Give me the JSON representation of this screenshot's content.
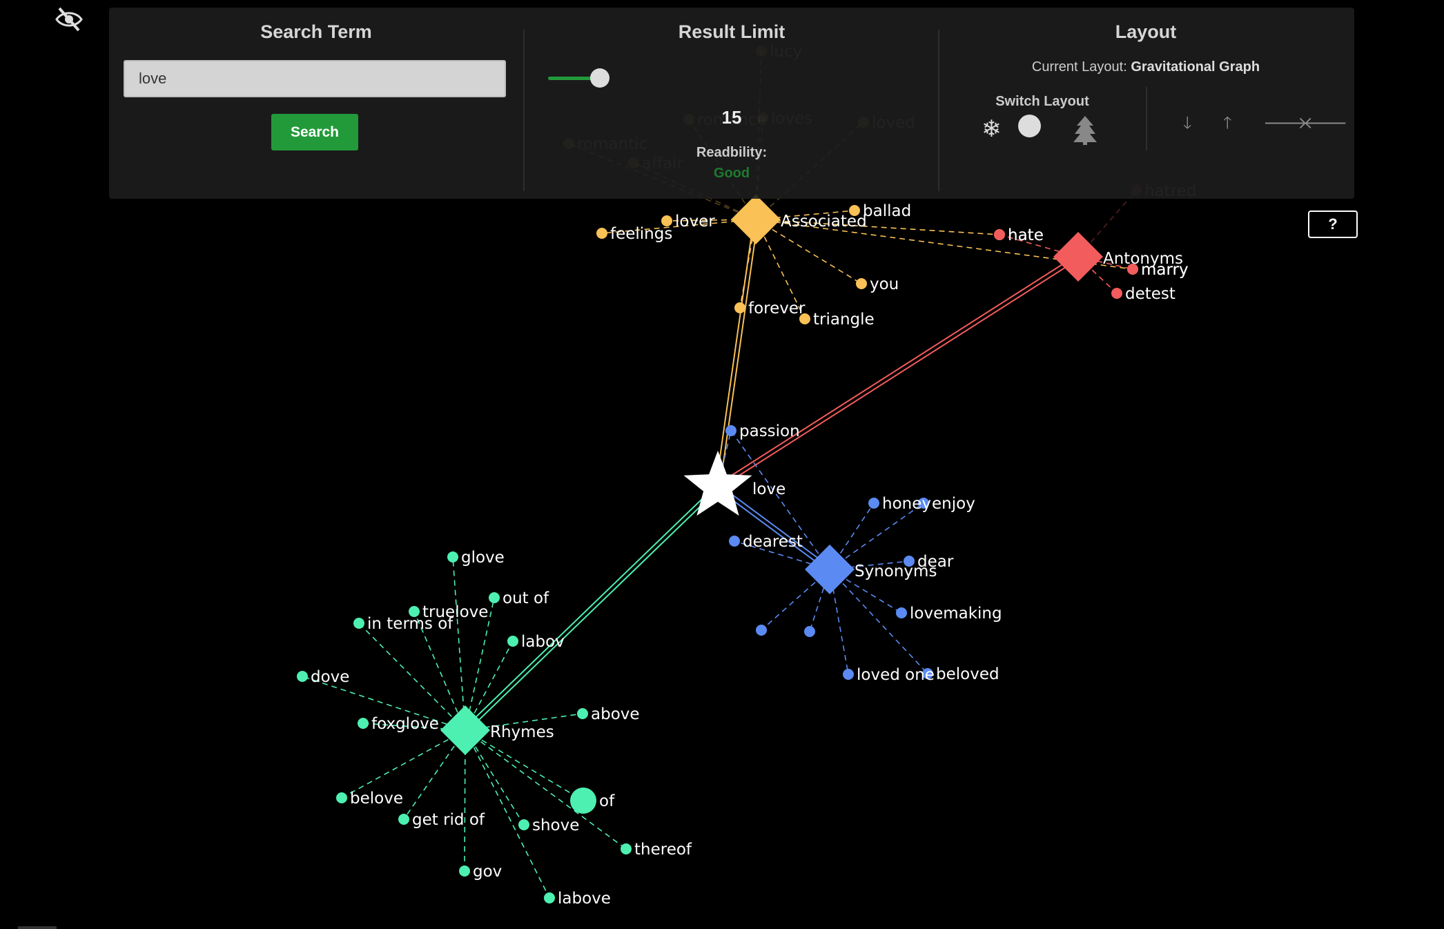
{
  "search": {
    "title": "Search Term",
    "value": "love",
    "button": "Search"
  },
  "limit": {
    "title": "Result Limit",
    "value": "15",
    "readability_label": "Readbility:",
    "readability_value": "Good"
  },
  "layout": {
    "title": "Layout",
    "current_label": "Current Layout:",
    "current_value": "Gravitational Graph",
    "switch_label": "Switch Layout",
    "switch_icons": [
      "snowflake-icon",
      "tree-icon"
    ],
    "arrow_icons": [
      "arrow-down-icon",
      "arrow-up-icon",
      "arrow-right-icon",
      "arrow-left-icon"
    ]
  },
  "help": "?",
  "colors": {
    "associated": "#f9c156",
    "antonyms": "#f25c5c",
    "synonyms": "#5b8bf2",
    "rhymes": "#4df0b0",
    "accent": "#229a3a"
  },
  "graph": {
    "center": "love",
    "hubs": {
      "associated": "Associated",
      "antonyms": "Antonyms",
      "synonyms": "Synonyms",
      "rhymes": "Rhymes"
    },
    "associated_words": [
      "lucy",
      "romance",
      "loves",
      "loved",
      "romantic",
      "affair",
      "feelings",
      "lover",
      "ballad",
      "hate",
      "marry",
      "you",
      "forever",
      "triangle"
    ],
    "antonym_words": [
      "hatred",
      "hate",
      "detest",
      "marry"
    ],
    "synonym_words": [
      "passion",
      "honey",
      "enjoy",
      "dearest",
      "dear",
      "lovemaking",
      "loved one",
      "beloved"
    ],
    "rhyme_words": [
      "glove",
      "out of",
      "truelove",
      "in terms of",
      "labov",
      "dove",
      "above",
      "foxglove",
      "belove",
      "get rid of",
      "of",
      "shove",
      "thereof",
      "gov",
      "labove"
    ]
  }
}
